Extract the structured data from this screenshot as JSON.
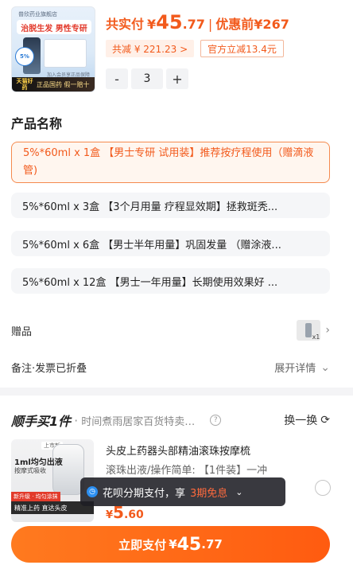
{
  "product": {
    "thumb": {
      "store": "普欣药业旗舰店",
      "headline": "治脱生发 男性专研",
      "percent": "5%",
      "note": "加入会员享正品保障",
      "badge_cat": "天猫好药",
      "badge_text": "正品国药 假一赔十"
    },
    "price_label": "共实付",
    "price_yen": "¥",
    "price_int": "45",
    "price_dec": ".77",
    "price_sep": "|",
    "price_before": "优惠前¥267",
    "saved_chip": "共减 ¥ 221.23 >",
    "official_chip": "官方立减13.4元",
    "qty_minus": "-",
    "qty_value": "3",
    "qty_plus": "+"
  },
  "spec": {
    "title": "产品名称",
    "options": [
      {
        "label": "5%*60ml x 1盒 【男士专研 试用装】推荐按疗程使用（赠滴液管)",
        "selected": true
      },
      {
        "label": "5%*60ml x 3盒 【3个月用量 疗程显效期】拯救斑秃...",
        "selected": false
      },
      {
        "label": "5%*60ml x 6盒 【男士半年用量】巩固发量 （赠涂液...",
        "selected": false
      },
      {
        "label": "5%*60ml x 12盒 【男士一年用量】长期使用效果好 ...",
        "selected": false
      }
    ]
  },
  "gift": {
    "label": "赠品",
    "count": "x1",
    "chevron": "›"
  },
  "invoice": {
    "label": "备注·发票已折叠",
    "expand": "展开详情",
    "chevron": "⌄"
  },
  "combo": {
    "brand": "顺手买1件",
    "dot": "·",
    "store": "时间煮雨居家百货特卖批...",
    "help": "?",
    "swap": "换一换",
    "swap_icon": "⟳",
    "image": {
      "top_tag": "上市新",
      "line1": "1ml均匀出液",
      "line2": "按摩式吸收",
      "red_tag": "新升级 · 均匀涂抹",
      "strip": "精准上药  直达头皮"
    },
    "title": "头皮上药器头部精油滚珠按摩梳",
    "desc": "滚珠出液/操作简单: 【1件装】一冲",
    "price_yen": "¥",
    "price_int": "5",
    "price_dec": ".60"
  },
  "toast": {
    "text": "花呗分期支付，享",
    "highlight": "3期免息",
    "chevron": "⌄"
  },
  "pay": {
    "label": "立即支付",
    "yen": "¥",
    "int": "45",
    "dec": ".77"
  },
  "colors": {
    "accent": "#f25a1c",
    "button": "#ff6a17",
    "option_bg": "#f5f6f8"
  }
}
